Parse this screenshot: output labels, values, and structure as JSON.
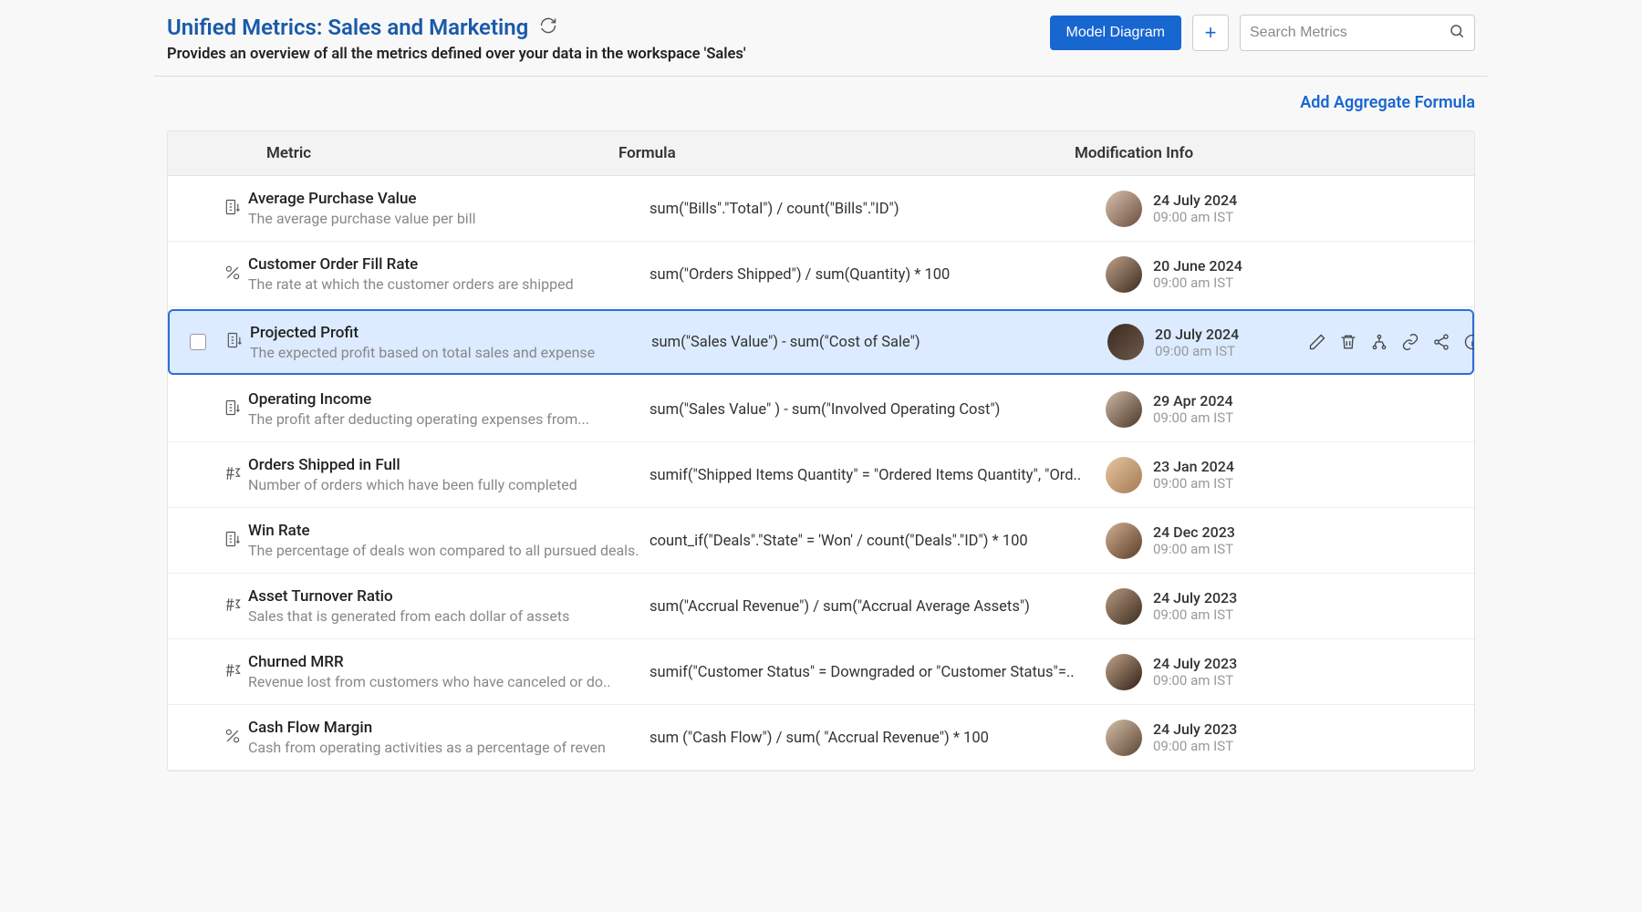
{
  "header": {
    "title": "Unified Metrics: Sales and Marketing",
    "subtitle": "Provides an overview of all the metrics defined over your data in the workspace 'Sales'",
    "model_diagram_label": "Model Diagram",
    "search_placeholder": "Search Metrics"
  },
  "linkbar": {
    "add_aggregate_label": "Add Aggregate Formula"
  },
  "columns": {
    "metric": "Metric",
    "formula": "Formula",
    "mod": "Modification Info"
  },
  "rows": [
    {
      "icon": "number",
      "name": "Average Purchase Value",
      "desc": "The average purchase value per bill",
      "formula": "sum(\"Bills\".\"Total\") / count(\"Bills\".\"ID\")",
      "date": "24 July 2024",
      "time": "09:00 am IST",
      "selected": false
    },
    {
      "icon": "percent",
      "name": "Customer Order Fill Rate",
      "desc": "The rate at which the customer orders are shipped",
      "formula": "sum(\"Orders Shipped\") / sum(Quantity) * 100",
      "date": "20 June 2024",
      "time": "09:00 am IST",
      "selected": false
    },
    {
      "icon": "number",
      "name": "Projected Profit",
      "desc": "The expected profit based on total sales and expense",
      "formula": "sum(\"Sales Value\") - sum(\"Cost of Sale\")",
      "date": "20 July 2024",
      "time": "09:00 am IST",
      "selected": true
    },
    {
      "icon": "number",
      "name": "Operating Income",
      "desc": "The profit after deducting operating expenses from...",
      "formula": "sum(\"Sales Value\" ) - sum(\"Involved Operating Cost\")",
      "date": "29 Apr 2024",
      "time": "09:00 am IST",
      "selected": false
    },
    {
      "icon": "hash-sigma",
      "name": "Orders Shipped in Full",
      "desc": "Number of orders which have been fully completed",
      "formula": "sumif(\"Shipped Items Quantity\" = \"Ordered Items Quantity\", \"Ord..",
      "date": "23 Jan 2024",
      "time": "09:00 am IST",
      "selected": false
    },
    {
      "icon": "number",
      "name": "Win Rate",
      "desc": "The percentage of deals won compared to all pursued deals.",
      "formula": "count_if(\"Deals\".\"State\" = 'Won' / count(\"Deals\".\"ID\") * 100",
      "date": "24 Dec 2023",
      "time": "09:00 am IST",
      "selected": false
    },
    {
      "icon": "hash-sigma",
      "name": "Asset Turnover Ratio",
      "desc": "Sales that is generated from each dollar of assets",
      "formula": "sum(\"Accrual Revenue\") / sum(\"Accrual Average Assets\")",
      "date": "24 July 2023",
      "time": "09:00 am IST",
      "selected": false
    },
    {
      "icon": "hash-sigma",
      "name": "Churned MRR",
      "desc": "Revenue lost from customers who have canceled or do..",
      "formula": "sumif(\"Customer Status\" = Downgraded or \"Customer Status\"=..",
      "date": "24 July 2023",
      "time": "09:00 am IST",
      "selected": false
    },
    {
      "icon": "percent",
      "name": "Cash Flow Margin",
      "desc": "Cash from operating activities as a percentage of reven",
      "formula": "sum (\"Cash Flow\") / sum( \"Accrual Revenue\") * 100",
      "date": "24 July 2023",
      "time": "09:00 am IST",
      "selected": false
    }
  ],
  "actions": {
    "edit": "edit",
    "delete": "delete",
    "dependents": "dependents",
    "link": "link",
    "share": "share",
    "info": "info"
  }
}
